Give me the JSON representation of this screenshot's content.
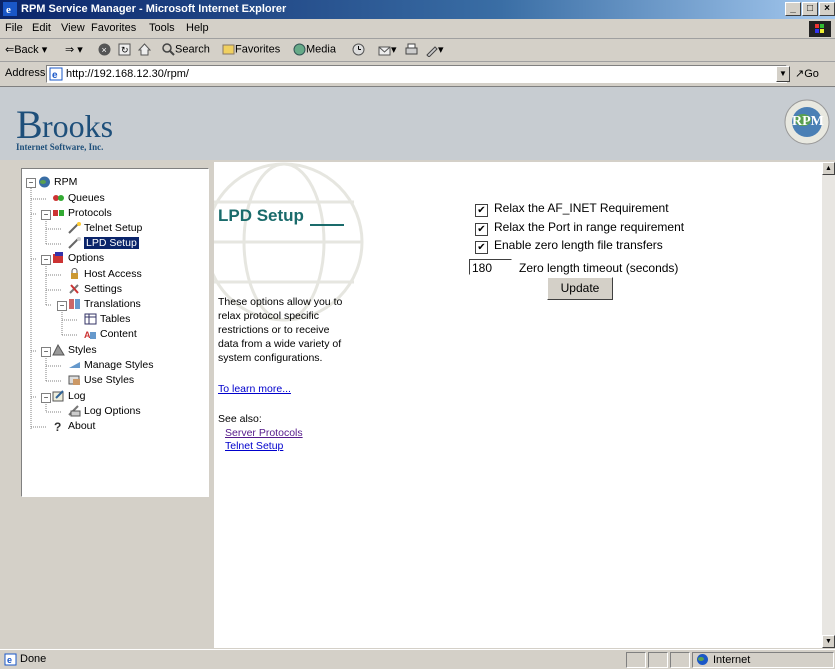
{
  "window": {
    "title": "RPM Service Manager - Microsoft Internet Explorer",
    "buttons": [
      "_",
      "□",
      "×"
    ]
  },
  "menubar": {
    "items": [
      "File",
      "Edit",
      "View",
      "Favorites",
      "Tools",
      "Help"
    ]
  },
  "toolbar": {
    "back": "Back",
    "search": "Search",
    "favorites": "Favorites",
    "media": "Media"
  },
  "address": {
    "label": "Address",
    "url": "http://192.168.12.30/rpm/",
    "go": "Go"
  },
  "banner": {
    "brand_big": "rooks",
    "brand_sub": "Internet Software, Inc.",
    "logo_text": "RPM"
  },
  "tree": {
    "items": [
      {
        "label": "RPM",
        "icon": "rpm-icon"
      },
      {
        "label": "Queues",
        "icon": "queues-icon"
      },
      {
        "label": "Protocols",
        "icon": "protocols-icon"
      },
      {
        "label": "Telnet Setup",
        "icon": "telnet-icon"
      },
      {
        "label": "LPD Setup",
        "icon": "lpd-icon",
        "selected": true
      },
      {
        "label": "Options",
        "icon": "options-icon"
      },
      {
        "label": "Host Access",
        "icon": "host-access-icon"
      },
      {
        "label": "Settings",
        "icon": "settings-icon"
      },
      {
        "label": "Translations",
        "icon": "translations-icon"
      },
      {
        "label": "Tables",
        "icon": "tables-icon"
      },
      {
        "label": "Content",
        "icon": "content-icon"
      },
      {
        "label": "Styles",
        "icon": "styles-icon"
      },
      {
        "label": "Manage Styles",
        "icon": "manage-styles-icon"
      },
      {
        "label": "Use Styles",
        "icon": "use-styles-icon"
      },
      {
        "label": "Log",
        "icon": "log-icon"
      },
      {
        "label": "Log Options",
        "icon": "log-options-icon"
      },
      {
        "label": "About",
        "icon": "about-icon"
      }
    ]
  },
  "main": {
    "title": "LPD Setup",
    "description": "These options allow you to relax protocol specific restrictions or to receive data from a wide variety of system configurations.",
    "learn_more": "To learn more...",
    "see_also": "See also:",
    "links": [
      "Server Protocols",
      "Telnet Setup"
    ],
    "checkboxes": [
      {
        "label": "Relax the AF_INET Requirement",
        "checked": true
      },
      {
        "label": "Relax the Port in range requirement",
        "checked": true
      },
      {
        "label": "Enable zero length file transfers",
        "checked": true
      }
    ],
    "timeout_value": "180",
    "timeout_label": "Zero length timeout (seconds)",
    "update_label": "Update"
  },
  "status": {
    "text": "Done",
    "zone": "Internet"
  },
  "colors": {
    "title_accent": "#1a6b6b",
    "selection": "#0a246a",
    "link": "#0000cc",
    "visited_link": "#551a8b"
  }
}
